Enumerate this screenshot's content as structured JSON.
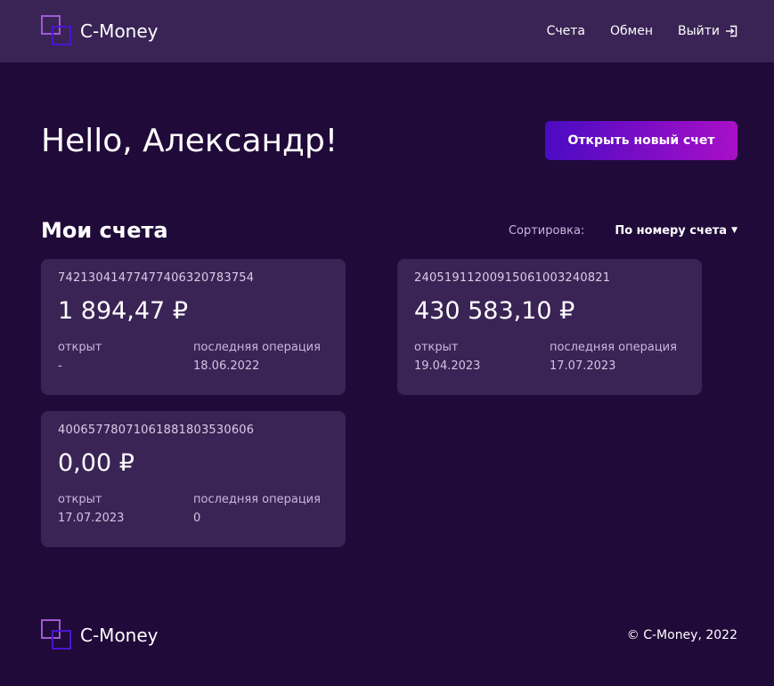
{
  "header": {
    "brand": "C-Money",
    "nav": [
      {
        "label": "Счета"
      },
      {
        "label": "Обмен"
      },
      {
        "label": "Выйти"
      }
    ]
  },
  "hero": {
    "greeting": "Hello, Александр!",
    "new_account_button": "Открыть новый счет"
  },
  "accounts": {
    "title": "Мои счета",
    "sort_label": "Сортировка:",
    "sort_value": "По номеру счета",
    "list": [
      {
        "number": "74213041477477406320783754",
        "balance": "1 894,47 ₽",
        "opened_label": "открыт",
        "opened": "-",
        "last_label": "последняя операция",
        "last": "18.06.2022"
      },
      {
        "number": "24051911200915061003240821",
        "balance": "430 583,10 ₽",
        "opened_label": "открыт",
        "opened": "19.04.2023",
        "last_label": "последняя операция",
        "last": "17.07.2023"
      },
      {
        "number": "40065778071061881803530606",
        "balance": "0,00 ₽",
        "opened_label": "открыт",
        "opened": "17.07.2023",
        "last_label": "последняя операция",
        "last": "0"
      }
    ]
  },
  "footer": {
    "brand": "C-Money",
    "copyright": "© C-Money, 2022"
  },
  "colors": {
    "background": "#200a39",
    "surface": "#3a2455",
    "accent_start": "#4a0bc2",
    "accent_end": "#a90fc8"
  }
}
